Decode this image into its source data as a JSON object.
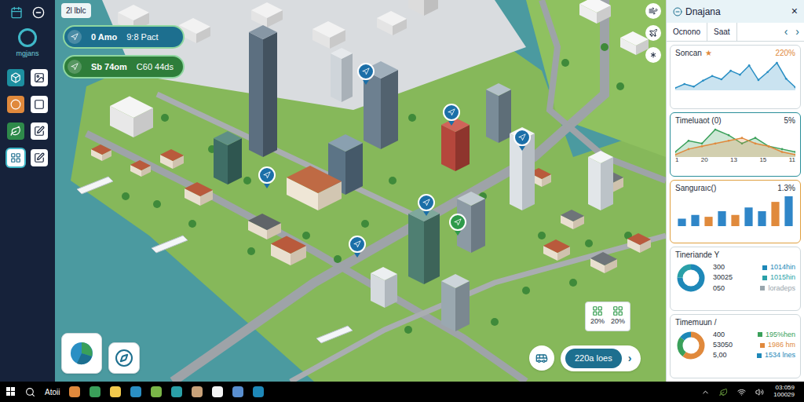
{
  "header": {
    "label": "2l lblc"
  },
  "logo": {
    "label": "mgjans"
  },
  "sidebar": {
    "items": [
      {
        "selected": false
      },
      {
        "selected": false
      },
      {
        "selected": false
      },
      {
        "selected": false
      },
      {
        "selected": false
      },
      {
        "selected": false
      },
      {
        "selected": true
      },
      {
        "selected": false
      }
    ]
  },
  "pills": [
    {
      "primary": "0 Amo",
      "secondary": "9:8 Pact",
      "color": "#1d6f8f"
    },
    {
      "primary": "Sb 74om",
      "secondary": "C60 44ds",
      "color": "#2e7d3a"
    }
  ],
  "map": {
    "pins": [
      {
        "color": "#1b6fa8"
      },
      {
        "color": "#1b6fa8"
      },
      {
        "color": "#1b6fa8"
      },
      {
        "color": "#1b6fa8"
      },
      {
        "color": "#1b6fa8"
      },
      {
        "color": "#1b6fa8"
      },
      {
        "color": "#2e9a4a"
      }
    ]
  },
  "panel": {
    "title": "Dnajana",
    "close": "×",
    "prev": "‹",
    "next": "›",
    "tabs": [
      {
        "label": "Ocnono",
        "selected": false
      },
      {
        "label": "Saat",
        "selected": false
      }
    ],
    "cards": [
      {
        "kind": "line",
        "title": "Soncan",
        "mark": "★",
        "value": "220%",
        "series": [
          {
            "values": [
              3,
              3.6,
              3.2,
              4.1,
              4.8,
              4.3,
              5.6,
              5,
              6.4,
              4.2,
              5.4,
              6.8,
              4.4,
              3.1
            ],
            "color": "#2a8fc4"
          }
        ]
      },
      {
        "kind": "area",
        "title": "Timeluaot (0)",
        "value": "5%",
        "ticks": [
          "1",
          "20",
          "13",
          "15",
          "11"
        ],
        "series": [
          {
            "values": [
              2,
              4,
              3.5,
              6,
              5,
              3.5,
              4.5,
              3,
              2.5,
              2
            ],
            "color": "#3aa05a"
          },
          {
            "values": [
              1.5,
              2.5,
              3,
              3.5,
              4,
              4.5,
              3.5,
              3,
              2,
              1.5
            ],
            "color": "#e0893c"
          }
        ]
      },
      {
        "kind": "bar",
        "title": "Sanguraıc()",
        "value": "1.3%",
        "bars": [
          {
            "value": 2,
            "color": "#2f86c8"
          },
          {
            "value": 3,
            "color": "#2f86c8"
          },
          {
            "value": 2.5,
            "color": "#e08a3c"
          },
          {
            "value": 4,
            "color": "#2f86c8"
          },
          {
            "value": 3,
            "color": "#e08a3c"
          },
          {
            "value": 5,
            "color": "#2f86c8"
          },
          {
            "value": 4,
            "color": "#2f86c8"
          },
          {
            "value": 6.5,
            "color": "#e08a3c"
          },
          {
            "value": 8,
            "color": "#2f86c8"
          }
        ]
      },
      {
        "kind": "donut",
        "title": "Tineriande Y",
        "segments": [
          {
            "value": 75,
            "color": "#1e88b8"
          },
          {
            "value": 25,
            "color": "#2aa0a8"
          }
        ],
        "rows": [
          {
            "value": "300",
            "legend": "1014hin",
            "color": "#1e88b8"
          },
          {
            "value": "30025",
            "legend": "1015hin",
            "color": "#2aa0a8"
          },
          {
            "value": "050",
            "legend": "loradeps",
            "color": "#9aa6ad"
          }
        ]
      },
      {
        "kind": "donut",
        "title": "Timemuun /",
        "segments": [
          {
            "value": 60,
            "color": "#e0893c"
          },
          {
            "value": 25,
            "color": "#3aa05a"
          },
          {
            "value": 15,
            "color": "#1e88b8"
          }
        ],
        "rows": [
          {
            "value": "400",
            "legend": "195%hen",
            "color": "#3aa05a"
          },
          {
            "value": "53050",
            "legend": "1986 hm",
            "color": "#e0893c"
          },
          {
            "value": "5,00",
            "legend": "1534 lnes",
            "color": "#1e88b8"
          }
        ]
      }
    ]
  },
  "overlay": {
    "stats": [
      {
        "value": "20%"
      },
      {
        "value": "20%"
      }
    ],
    "action": {
      "label": "220a loes",
      "arrow": "›"
    }
  },
  "taskbar": {
    "search_label": "Atoii",
    "time": "03:059",
    "date": "100029"
  }
}
